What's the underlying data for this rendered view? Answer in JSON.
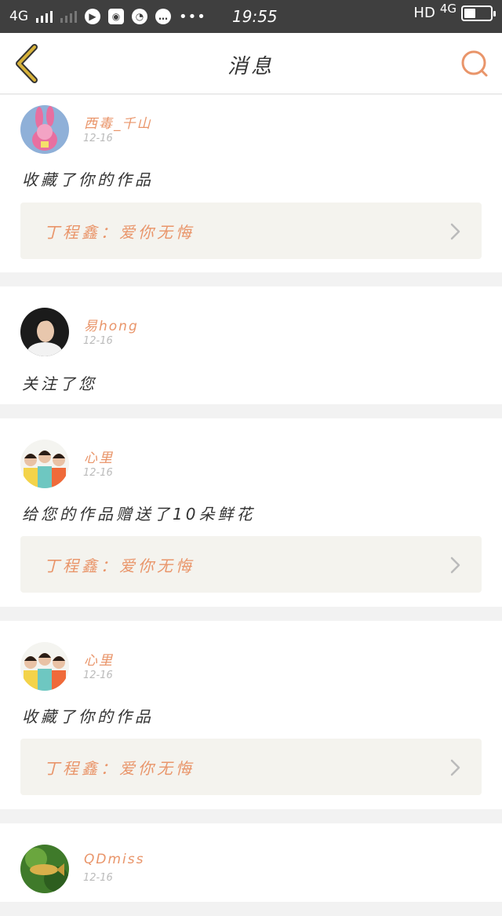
{
  "status_bar": {
    "network": "4G",
    "time": "19:55",
    "hd_label": "HD",
    "net_right": "4G",
    "battery_level": 0.45
  },
  "header": {
    "title": "消息",
    "back_icon": "chevron-left-icon",
    "search_icon": "search-icon"
  },
  "colors": {
    "accent": "#e9956a",
    "back_icon": "#d7b23a",
    "quote_bg": "#f4f3ee",
    "status_bg": "#3f3f3f"
  },
  "messages": [
    {
      "user": "西毒_千山",
      "date": "12-16",
      "action": "收藏了你的作品",
      "quote": "丁程鑫：爱你无悔"
    },
    {
      "user": "易hong",
      "date": "12-16",
      "action": "关注了您"
    },
    {
      "user": "心里",
      "date": "12-16",
      "action": "给您的作品赠送了10朵鲜花",
      "quote": "丁程鑫：爱你无悔"
    },
    {
      "user": "心里",
      "date": "12-16",
      "action": "收藏了你的作品",
      "quote": "丁程鑫：爱你无悔"
    },
    {
      "user": "QDmiss",
      "date": "12-16"
    }
  ]
}
